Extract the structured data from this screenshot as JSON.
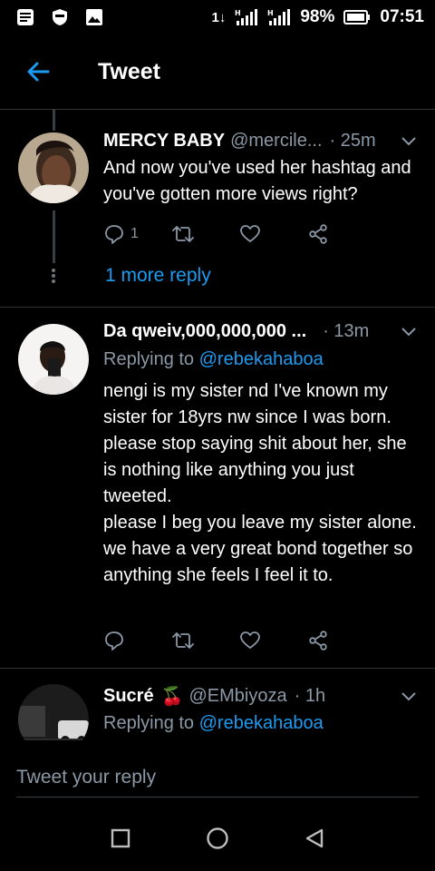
{
  "status_bar": {
    "network_type": "1↓",
    "signal_label_1": "H",
    "signal_label_2": "H",
    "battery": "98%",
    "time": "07:51",
    "icons": [
      "notes-icon",
      "shield-icon",
      "image-icon",
      "data-arrows-icon",
      "signal-icon",
      "signal-icon",
      "battery-icon"
    ]
  },
  "header": {
    "title": "Tweet",
    "back_icon": "back-arrow-icon",
    "accent": "#1d9bf0"
  },
  "tweets": [
    {
      "name": "MERCY BABY",
      "handle": "@mercile...",
      "time": "· 25m",
      "text": "And now you've used her hashtag and you've gotten more views right?",
      "reply_count": "1",
      "more_replies": "1 more reply"
    },
    {
      "name": "Da qweiv,000,000,000 ...",
      "handle": "",
      "time": "· 13m",
      "replying_prefix": "Replying to",
      "replying_to": "@rebekahaboa",
      "text": "nengi is my sister nd I've known my sister for 18yrs nw since I was born. please stop saying shit about her, she is nothing like anything you just tweeted.\nplease I beg you leave my sister alone. we have a very great bond together so anything she feels I feel it to."
    },
    {
      "name": "Sucré",
      "emoji": "🍒",
      "handle": "@EMbiyoza",
      "time": "· 1h",
      "replying_prefix": "Replying to",
      "replying_to": "@rebekahaboa"
    }
  ],
  "reply_bar": {
    "placeholder": "Tweet your reply"
  },
  "colors": {
    "background": "#000000",
    "secondary_text": "#8b98a5",
    "link": "#1d9bf0",
    "divider": "#2f3336"
  }
}
